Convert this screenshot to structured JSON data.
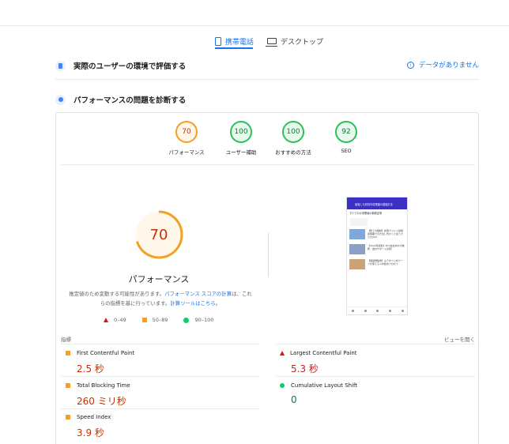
{
  "tabs": {
    "mobile_label": "携帯電話",
    "desktop_label": "デスクトップ"
  },
  "crux": {
    "title": "実際のユーザーの環境で評価する",
    "no_data": "データがありません"
  },
  "diagnose": {
    "title": "パフォーマンスの問題を診断する"
  },
  "scores": [
    {
      "value": "70",
      "label": "パフォーマンス",
      "status": "average"
    },
    {
      "value": "100",
      "label": "ユーザー補助",
      "status": "pass"
    },
    {
      "value": "100",
      "label": "おすすめの方法",
      "status": "pass"
    },
    {
      "value": "92",
      "label": "SEO",
      "status": "pass"
    }
  ],
  "performance": {
    "score": "70",
    "score_fraction": 0.7,
    "label": "パフォーマンス",
    "note_pre": "推定値のため変動する可能性があります。",
    "note_link1": "パフォーマンス スコアの計算",
    "note_mid": "は、これらの指標を基に行っています。",
    "note_link2": "計算ツールはこちら。"
  },
  "legend": {
    "fail": "0–49",
    "average": "50–89",
    "pass": "90–100"
  },
  "screenshot": {
    "header_text": "最強した好評中保育園の退園方法",
    "title_text": "マイクロ小事業後の新着記事",
    "items": [
      "【総ての相談】新型ウイルス感染症時期で引き出し代わって最うざさ日のAI",
      "【2024年最新】中小会社向けの税務・会計サポート比較！",
      "【保健師監修】もうすぐ公式ナースが使える人材集めプロセス"
    ]
  },
  "metrics": {
    "heading": "指標",
    "expand_label": "ビューを開く",
    "items": [
      {
        "name": "First Contentful Paint",
        "value": "2.5 秒",
        "status": "average"
      },
      {
        "name": "Largest Contentful Paint",
        "value": "5.3 秒",
        "status": "fail"
      },
      {
        "name": "Total Blocking Time",
        "value": "260 ミリ秒",
        "status": "average"
      },
      {
        "name": "Cumulative Layout Shift",
        "value": "0",
        "status": "pass"
      },
      {
        "name": "Speed Index",
        "value": "3.9 秒",
        "status": "average"
      }
    ]
  },
  "colors": {
    "accent": "#1a73e8",
    "fail": "#eb0f00",
    "average": "#f4a020",
    "pass": "#0cce6b"
  }
}
